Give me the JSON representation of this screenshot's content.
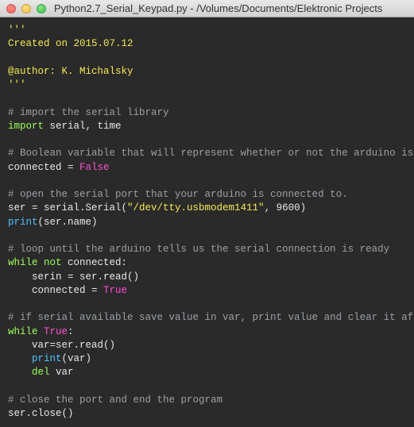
{
  "window": {
    "title": "Python2.7_Serial_Keypad.py - /Volumes/Documents/Elektronic Projects"
  },
  "code": {
    "l1": "'''",
    "l2": "Created on 2015.07.12",
    "l3": "",
    "l4": "@author: K. Michalsky",
    "l5": "'''",
    "l6": "",
    "l7": "# import the serial library",
    "l8a": "import",
    "l8b": " serial, time",
    "l9": "",
    "l10": "# Boolean variable that will represent whether or not the arduino is connected",
    "l11a": "connected = ",
    "l11b": "False",
    "l12": "",
    "l13": "# open the serial port that your arduino is connected to.",
    "l14a": "ser = serial.Serial(",
    "l14b": "\"/dev/tty.usbmodem1411\"",
    "l14c": ", 9600)",
    "l15a": "print",
    "l15b": "(ser.name)",
    "l16": "",
    "l17": "# loop until the arduino tells us the serial connection is ready",
    "l18a": "while not",
    "l18b": " connected:",
    "l19": "    serin = ser.read()",
    "l20a": "    connected = ",
    "l20b": "True",
    "l21": "",
    "l22": "# if serial available save value in var, print value and clear it afterwards for new input",
    "l23a": "while ",
    "l23b": "True",
    "l23c": ":",
    "l24": "    var=ser.read()",
    "l25a": "    ",
    "l25b": "print",
    "l25c": "(var)",
    "l26a": "    ",
    "l26b": "del",
    "l26c": " var",
    "l27": "",
    "l28": "# close the port and end the program",
    "l29": "ser.close()"
  }
}
